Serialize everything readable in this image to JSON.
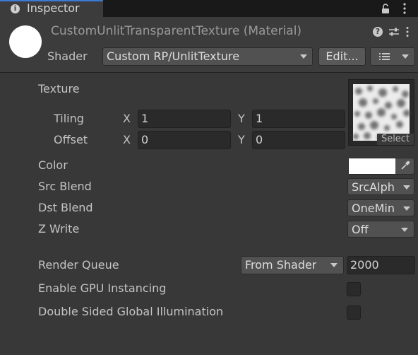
{
  "tab": {
    "title": "Inspector",
    "icon": "info-icon"
  },
  "header": {
    "material_title": "CustomUnlitTransparentTexture (Material)",
    "shader_label": "Shader",
    "shader_value": "Custom RP/UnlitTexture",
    "edit_label": "Edit...",
    "icons": [
      "help-icon",
      "presets-icon",
      "more-icon",
      "lock-icon"
    ]
  },
  "properties": {
    "texture_label": "Texture",
    "tiling_label": "Tiling",
    "offset_label": "Offset",
    "x_label": "X",
    "y_label": "Y",
    "tiling_x": "1",
    "tiling_y": "1",
    "offset_x": "0",
    "offset_y": "0",
    "select_label": "Select",
    "color_label": "Color",
    "color_value": "#ffffff",
    "src_blend_label": "Src Blend",
    "src_blend_value": "SrcAlph",
    "dst_blend_label": "Dst Blend",
    "dst_blend_value": "OneMin",
    "zwrite_label": "Z Write",
    "zwrite_value": "Off"
  },
  "advanced": {
    "render_queue_label": "Render Queue",
    "render_queue_mode": "From Shader",
    "render_queue_value": "2000",
    "gpu_instancing_label": "Enable GPU Instancing",
    "gpu_instancing_checked": false,
    "double_sided_gi_label": "Double Sided Global Illumination",
    "double_sided_gi_checked": false
  },
  "colors": {
    "background": "#383838",
    "header": "#3c3c3c",
    "tabbar": "#191919",
    "accent": "#3a7bd5"
  }
}
